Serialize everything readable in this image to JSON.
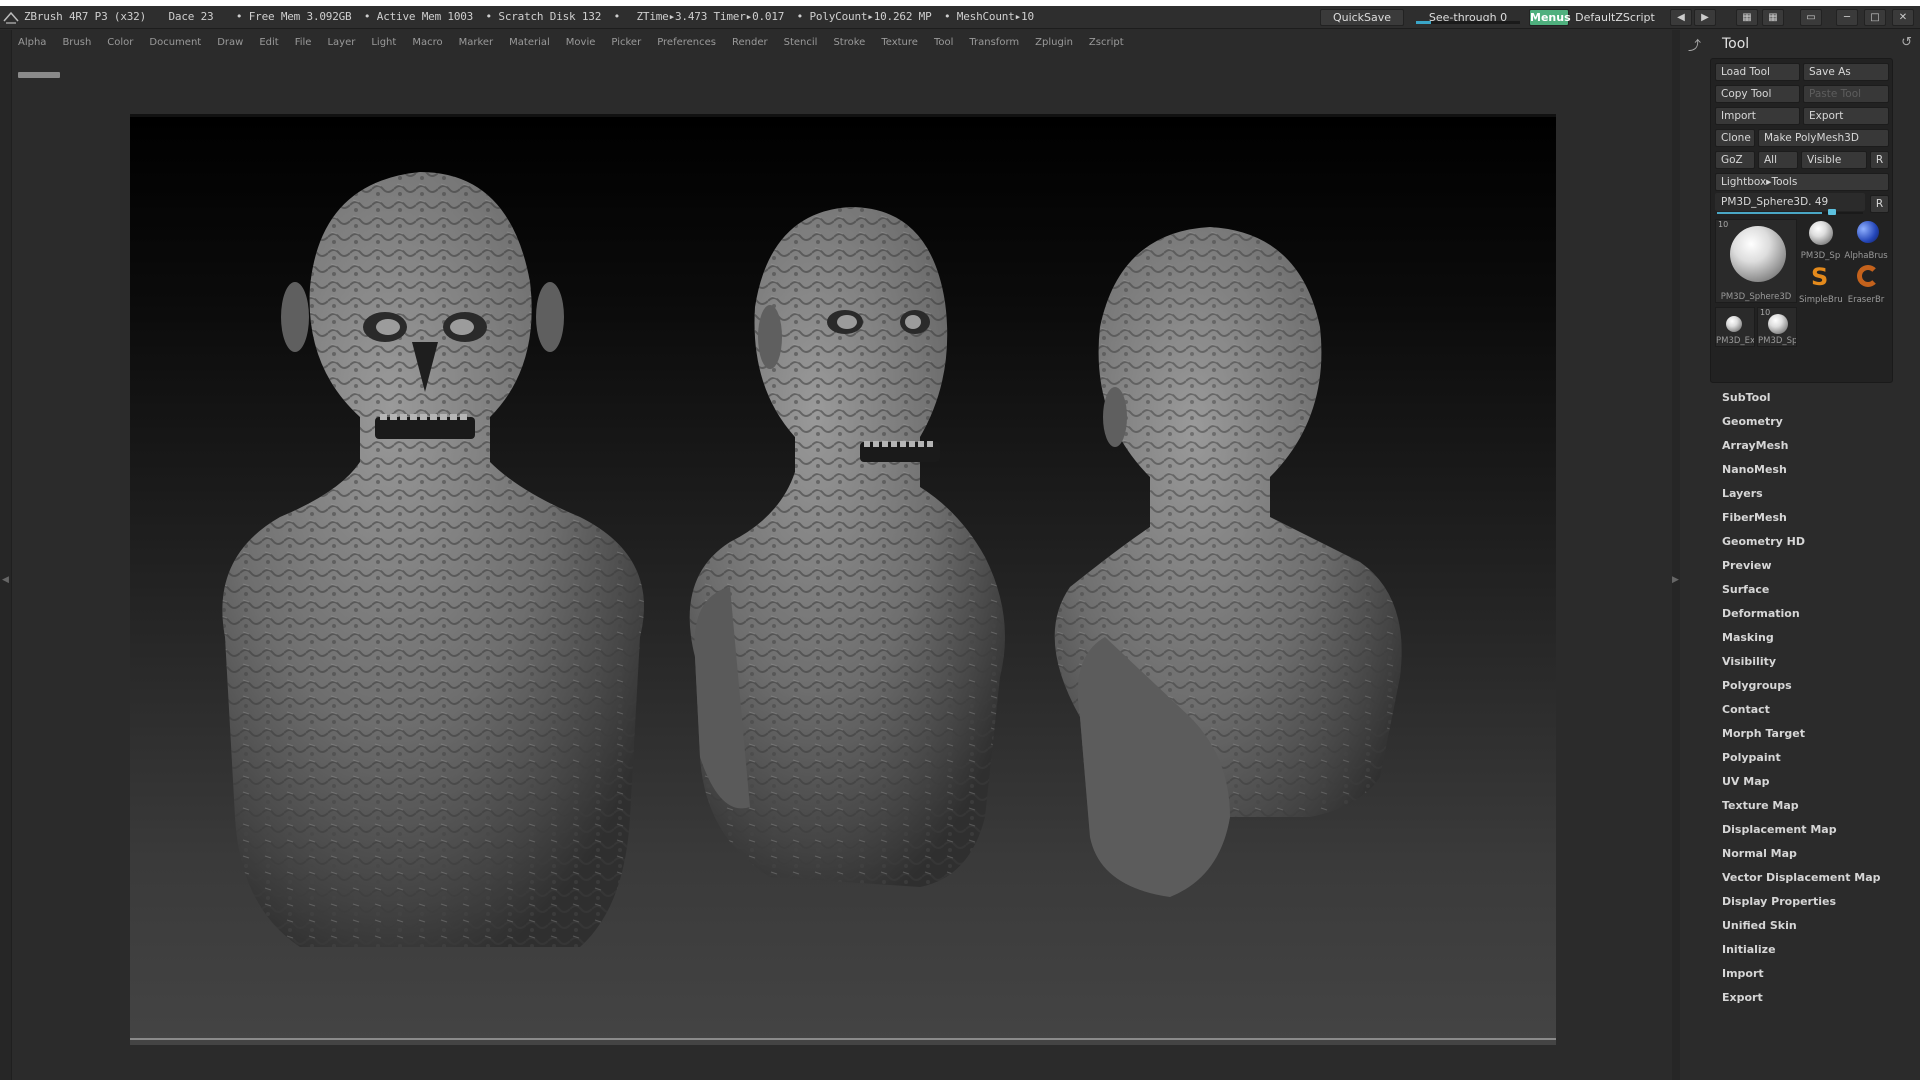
{
  "titlebar": {
    "app": "ZBrush 4R7 P3 (x32)",
    "document": "Dace 23",
    "free_mem": "• Free Mem 3.092GB",
    "active_mem": "• Active Mem 1003",
    "scratch_disk": "• Scratch Disk 132",
    "bullet": "•",
    "ztime": "ZTime▸3.473 Timer▸0.017",
    "polycount": "• PolyCount▸10.262 MP",
    "meshcount": "• MeshCount▸10",
    "quicksave": "QuickSave",
    "seethrough": "See-through  0",
    "seethrough_value": 0,
    "menus": "Menus",
    "script": "DefaultZScript"
  },
  "menu": [
    "Alpha",
    "Brush",
    "Color",
    "Document",
    "Draw",
    "Edit",
    "File",
    "Layer",
    "Light",
    "Macro",
    "Marker",
    "Material",
    "Movie",
    "Picker",
    "Preferences",
    "Render",
    "Stencil",
    "Stroke",
    "Texture",
    "Tool",
    "Transform",
    "Zplugin",
    "Zscript"
  ],
  "tool_palette": {
    "title": "Tool",
    "load_tool": "Load Tool",
    "save_as": "Save As",
    "copy_tool": "Copy Tool",
    "paste_tool": "Paste Tool",
    "import": "Import",
    "export": "Export",
    "clone": "Clone",
    "make_polymesh": "Make PolyMesh3D",
    "goz": "GoZ",
    "all": "All",
    "visible": "Visible",
    "r": "R",
    "lightbox_tools": "Lightbox▸Tools",
    "current_tool": "PM3D_Sphere3D. 49",
    "current_tool_r": "R",
    "thumbnails": [
      {
        "num": "10",
        "label": "PM3D_Sphere3D"
      },
      {
        "num": "",
        "label": "PM3D_Sp"
      },
      {
        "num": "",
        "label": "AlphaBrus"
      },
      {
        "num": "",
        "label": "SimpleBrus"
      },
      {
        "num": "",
        "label": "EraserBr"
      },
      {
        "num": "",
        "label": "PM3D_Ex"
      },
      {
        "num": "10",
        "label": "PM3D_Sp"
      }
    ],
    "sections": [
      "SubTool",
      "Geometry",
      "ArrayMesh",
      "NanoMesh",
      "Layers",
      "FiberMesh",
      "Geometry HD",
      "Preview",
      "Surface",
      "Deformation",
      "Masking",
      "Visibility",
      "Polygroups",
      "Contact",
      "Morph Target",
      "Polypaint",
      "UV Map",
      "Texture Map",
      "Displacement Map",
      "Normal Map",
      "Vector Displacement Map",
      "Display Properties",
      "Unified Skin",
      "Initialize",
      "Import",
      "Export"
    ]
  },
  "colors": {
    "accent_menus": "#4fb07e",
    "slider": "#4aa7c5"
  }
}
